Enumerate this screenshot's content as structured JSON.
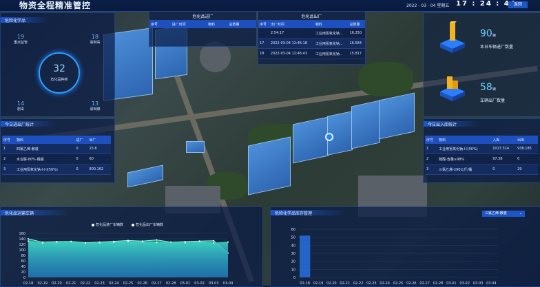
{
  "header": {
    "title": "物资全程精准管控",
    "date": "2022 - 03 - 04  星期五",
    "time": "17 : 24 : 44",
    "back_label": "返回"
  },
  "left_stats": {
    "title": "危险化学品",
    "center_value": "32",
    "center_label": "危化品种类",
    "items": [
      {
        "value": "19",
        "label": "重点监管"
      },
      {
        "value": "18",
        "label": "易制毒"
      },
      {
        "value": "14",
        "label": "剧毒"
      },
      {
        "value": "13",
        "label": "易制爆"
      }
    ]
  },
  "out_table_top": {
    "title": "危化品出厂",
    "headers": [
      "序号",
      "出厂时间",
      "物料",
      "总数量"
    ],
    "rows": [
      [
        "17",
        "2022-03-04 12:46:18",
        "工业用氢氧化钠...",
        "16.584"
      ],
      [
        "18",
        "2022-03-04 12:46:43",
        "工业用氢氧化钠...",
        "15.817"
      ]
    ],
    "partial_row": [
      "",
      "2:54:17",
      "工业用氢氧化钠...",
      "16.250"
    ]
  },
  "in_table_top": {
    "title": "危化品进厂",
    "headers": [
      "序号",
      "进厂时间",
      "物料",
      "总数量"
    ]
  },
  "today_out": {
    "title": "今日进出厂统计",
    "headers": [
      "序号",
      "物料",
      "进厂",
      "出厂"
    ],
    "rows": [
      [
        "1",
        "四氯乙烯-散装",
        "0",
        "15.6"
      ],
      [
        "2",
        "水合肼-80%-桶装",
        "0",
        "60"
      ],
      [
        "3",
        "工业用氢氧化钠-I-I-I(50%)",
        "0",
        "800.162"
      ]
    ]
  },
  "right_stats": {
    "in_value": "90",
    "in_unit": "辆",
    "in_label": "本日车辆进厂数量",
    "out_value": "58",
    "out_unit": "辆",
    "out_label": "车辆出厂数量"
  },
  "today_stock": {
    "title": "今日出入库统计",
    "headers": [
      "序号",
      "物料",
      "入库",
      "出库"
    ],
    "rows": [
      [
        "1",
        "工业用氢氧化钠-I-I(50%)",
        "1017.314",
        "938.185"
      ],
      [
        "2",
        "硫酸-含量≥98%",
        "97.38",
        "0"
      ],
      [
        "3",
        "三氯乙烯-290公斤/桶",
        "0",
        "29"
      ]
    ]
  },
  "vehicle_chart": {
    "title": "危化品运输车辆",
    "legend": [
      "危化品进厂车辆数",
      "危化品出厂车辆数"
    ]
  },
  "stock_chart": {
    "title": "危险化学品库存管理",
    "select_value": "三氯乙烯-散装"
  },
  "chart_data": [
    {
      "type": "area",
      "title": "危化品运输车辆",
      "x": [
        "02-18",
        "02-19",
        "02-20",
        "02-21",
        "02-22",
        "02-23",
        "02-24",
        "02-25",
        "02-26",
        "02-27",
        "02-28",
        "03-01",
        "03-02",
        "03-03",
        "03-04"
      ],
      "series": [
        {
          "name": "危化品进厂车辆数",
          "values": [
            132,
            125,
            128,
            130,
            124,
            126,
            128,
            131,
            129,
            127,
            128,
            126,
            130,
            125,
            128
          ]
        },
        {
          "name": "危化品出厂车辆数",
          "values": [
            140,
            128,
            130,
            131,
            126,
            128,
            131,
            134,
            132,
            136,
            128,
            130,
            132,
            133,
            88
          ]
        }
      ],
      "yticks": [
        0,
        20,
        40,
        60,
        80,
        100,
        120,
        140,
        160
      ],
      "ylim": [
        0,
        160
      ]
    },
    {
      "type": "bar",
      "title": "危险化学品库存管理",
      "x": [
        "02-18",
        "02-19",
        "02-20",
        "02-21",
        "02-22",
        "02-23",
        "02-24",
        "02-25",
        "02-26",
        "02-27",
        "02-28",
        "03-01",
        "03-02",
        "03-03",
        "03-04"
      ],
      "values": [
        52,
        0,
        0,
        0,
        0,
        0,
        0,
        0,
        0,
        0,
        0,
        0,
        0,
        0,
        0
      ],
      "yticks": [
        0,
        10,
        20,
        30,
        40,
        50,
        60
      ],
      "ylim": [
        0,
        60
      ]
    }
  ]
}
